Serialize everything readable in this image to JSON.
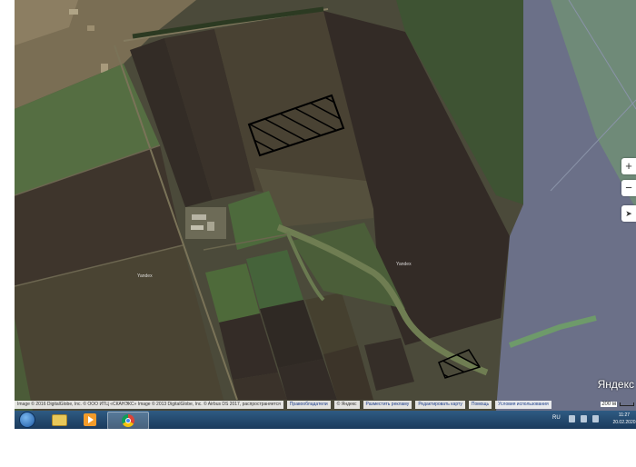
{
  "map": {
    "provider_logo": "Яндекс",
    "scale_label": "200 м",
    "field_labels": [
      "Yandex",
      "Yandex"
    ],
    "controls": {
      "zoom_in": "+",
      "zoom_out": "−",
      "locate": "➤"
    },
    "colors": {
      "hatch_stroke": "#000000",
      "field_dark": "#3d352c",
      "field_green": "#4f6a3c",
      "overlay_panel": "#6b7088"
    }
  },
  "footer": {
    "attribution": "Image © 2016 DigitalGlobe, Inc. © OOO ИТЦ «СКАНЭКС» Image © 2013 DigitalGlobe, Inc. © Airbus DS 2017, распространяется",
    "links": [
      "Правообладатели",
      "© Яндекс",
      "Разместить рекламу",
      "Редактировать карту",
      "Помощь",
      "Условия использования"
    ]
  },
  "taskbar": {
    "language": "RU",
    "time": "11:27",
    "date": "20.02.2020"
  }
}
